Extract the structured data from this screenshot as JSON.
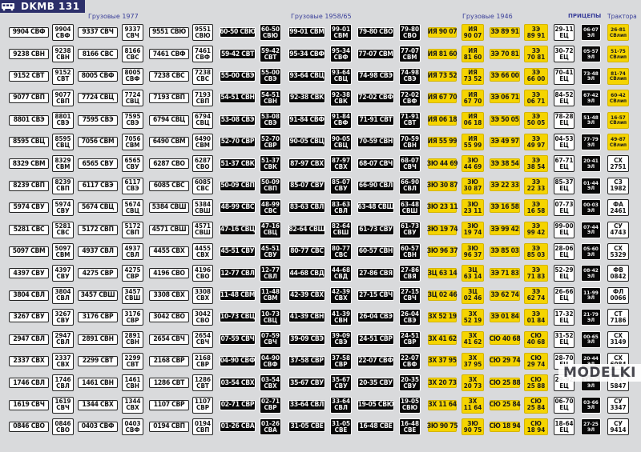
{
  "header": {
    "logo_icon": "bus-logo-icon",
    "title": "DKMB 131",
    "sections": [
      {
        "label": "Грузовые 1977"
      },
      {
        "label": "Грузовые 1958/65"
      },
      {
        "label": "Грузовые 1946"
      },
      {
        "label": "ПРИЦЕПЫ"
      },
      {
        "label": "Трактора"
      }
    ]
  },
  "watermark": "MODELKI",
  "colors": {
    "background": "#d9dadc",
    "header": "#2c2f6a",
    "section_text": "#3a3f9a",
    "plate_1977": "#ffffff",
    "plate_1958": "#080808",
    "plate_1946": "#f5d400"
  },
  "plates_1977": [
    {
      "a": "9904 СВФ",
      "b": "9904\nСВФ",
      "c": "9337 СВЧ",
      "d": "9337\nСВЧ",
      "e": "9551 СВЮ",
      "f": "9551\nСВЮ"
    },
    {
      "a": "9238 СВН",
      "b": "9238\nСВН",
      "c": "8166 СВС",
      "d": "8166\nСВС",
      "e": "7461 СВФ",
      "f": "7461\nСВФ"
    },
    {
      "a": "9152 СВТ",
      "b": "9152\nСВТ",
      "c": "8005 СВФ",
      "d": "8005\nСВФ",
      "e": "7238 СВС",
      "f": "7238\nСВС"
    },
    {
      "a": "9077 СВП",
      "b": "9077\nСВП",
      "c": "7724 СВЦ",
      "d": "7724\nСВЦ",
      "e": "7193 СВП",
      "f": "7193\nСВП"
    },
    {
      "a": "8801 СВЭ",
      "b": "8801\nСВЭ",
      "c": "7595 СВЭ",
      "d": "7595\nСВЭ",
      "e": "6794 СВЦ",
      "f": "6794\nСВЦ"
    },
    {
      "a": "8595 СВЦ",
      "b": "8595\nСВЦ",
      "c": "7056 СВМ",
      "d": "7056\nСВМ",
      "e": "6490 СВМ",
      "f": "6490\nСВМ"
    },
    {
      "a": "8329 СВМ",
      "b": "8329\nСВМ",
      "c": "6565 СВУ",
      "d": "6565\nСВУ",
      "e": "6287 СВО",
      "f": "6287\nСВО"
    },
    {
      "a": "8239 СВП",
      "b": "8239\nСВП",
      "c": "6117 СВЭ",
      "d": "6117\nСВЭ",
      "e": "6085 СВС",
      "f": "6085\nСВС"
    },
    {
      "a": "5974 СВУ",
      "b": "5974\nСВУ",
      "c": "5674 СВЦ",
      "d": "5674\nСВЦ",
      "e": "5384 СВШ",
      "f": "5384\nСВШ"
    },
    {
      "a": "5281 СВС",
      "b": "5281\nСВС",
      "c": "5172 СВП",
      "d": "5172\nСВП",
      "e": "4571 СВШ",
      "f": "4571\nСВШ"
    },
    {
      "a": "5097 СВМ",
      "b": "5097\nСВМ",
      "c": "4937 СВЛ",
      "d": "4937\nСВЛ",
      "e": "4455 СВХ",
      "f": "4455\nСВХ"
    },
    {
      "a": "4397 СВУ",
      "b": "4397\nСВУ",
      "c": "4275 СВР",
      "d": "4275\nСВР",
      "e": "4196 СВО",
      "f": "4196\nСВО"
    },
    {
      "a": "3804 СВЛ",
      "b": "3804\nСВЛ",
      "c": "3457 СВШ",
      "d": "3457\nСВШ",
      "e": "3308 СВХ",
      "f": "3308\nСВХ"
    },
    {
      "a": "3267 СВУ",
      "b": "3267\nСВУ",
      "c": "3176 СВР",
      "d": "3176\nСВР",
      "e": "3042 СВО",
      "f": "3042\nСВО"
    },
    {
      "a": "2947 СВЛ",
      "b": "2947\nСВЛ",
      "c": "2891 СВН",
      "d": "2891\nСВН",
      "e": "2654 СВЧ",
      "f": "2654\nСВЧ"
    },
    {
      "a": "2337 СВХ",
      "b": "2337\nСВХ",
      "c": "2299 СВТ",
      "d": "2299\nСВТ",
      "e": "2168 СВР",
      "f": "2168\nСВР"
    },
    {
      "a": "1746 СВЛ",
      "b": "1746\nСВЛ",
      "c": "1461 СВН",
      "d": "1461\nСВН",
      "e": "1286 СВТ",
      "f": "1286\nСВТ"
    },
    {
      "a": "1619 СВЧ",
      "b": "1619\nСВЧ",
      "c": "1344 СВХ",
      "d": "1344\nСВХ",
      "e": "1107 СВР",
      "f": "1107\nСВР"
    },
    {
      "a": "0846 СВО",
      "b": "0846\nСВО",
      "c": "0403 СВФ",
      "d": "0403\nСВФ",
      "e": "0194 СВП",
      "f": "0194\nСВП"
    }
  ],
  "plates_1958": [
    {
      "a": "60-50 СВЮ",
      "b": "60-50\nСВЮ",
      "c": "99-01 СВМ",
      "d": "99-01\nСВМ",
      "e": "79-80 СВО",
      "f": "79-80\nСВО"
    },
    {
      "a": "59-42 СВТ",
      "b": "59-42\nСВТ",
      "c": "95-34 СВФ",
      "d": "95-34\nСВФ",
      "e": "77-07 СВМ",
      "f": "77-07\nСВМ"
    },
    {
      "a": "55-00 СВЭ",
      "b": "55-00\nСВЭ",
      "c": "93-64 СВЦ",
      "d": "93-64\nСВЦ",
      "e": "74-98 СВЭ",
      "f": "74-98\nСВЭ"
    },
    {
      "a": "54-51 СВН",
      "b": "54-51\nСВН",
      "c": "92-38 СВК",
      "d": "92-38\nСВК",
      "e": "72-02 СВФ",
      "f": "72-02\nСВФ"
    },
    {
      "a": "53-08 СВЭ",
      "b": "53-08\nСВЭ",
      "c": "91-84 СВФ",
      "d": "91-84\nСВФ",
      "e": "71-91 СВТ",
      "f": "71-91\nСВТ"
    },
    {
      "a": "52-70 СВР",
      "b": "52-70\nСВР",
      "c": "90-05 СВЦ",
      "d": "90-05\nСВЦ",
      "e": "70-59 СВН",
      "f": "70-59\nСВН"
    },
    {
      "a": "51-37 СВК",
      "b": "51-37\nСВК",
      "c": "87-97 СВХ",
      "d": "87-97\nСВХ",
      "e": "68-07 СВЧ",
      "f": "68-07\nСВЧ"
    },
    {
      "a": "50-09 СВП",
      "b": "50-09\nСВП",
      "c": "85-07 СВУ",
      "d": "85-07\nСВУ",
      "e": "66-90 СВЛ",
      "f": "66-90\nСВЛ"
    },
    {
      "a": "48-99 СВС",
      "b": "48-99\nСВС",
      "c": "83-63 СВЛ",
      "d": "83-63\nСВЛ",
      "e": "63-48 СВШ",
      "f": "63-48\nСВШ"
    },
    {
      "a": "47-16 СВЦ",
      "b": "47-16\nСВЦ",
      "c": "82-64 СВШ",
      "d": "82-64\nСВШ",
      "e": "61-73 СВУ",
      "f": "61-73\nСВУ"
    },
    {
      "a": "45-51 СВУ",
      "b": "45-51\nСВУ",
      "c": "80-77 СВС",
      "d": "80-77\nСВС",
      "e": "60-57 СВН",
      "f": "60-57\nСВН"
    },
    {
      "a": "12-77 СВЛ",
      "b": "12-77\nСВЛ",
      "c": "44-68 СВД",
      "d": "44-68\nСВД",
      "e": "27-86 СВЯ",
      "f": "27-86\nСВЯ"
    },
    {
      "a": "11-48 СВМ",
      "b": "11-48\nСВМ",
      "c": "42-39 СВХ",
      "d": "42-39\nСВХ",
      "e": "27-15 СВЧ",
      "f": "27-15\nСВЧ"
    },
    {
      "a": "10-73 СВЦ",
      "b": "10-73\nСВЦ",
      "c": "41-39 СВН",
      "d": "41-39\nСВН",
      "e": "26-04 СВЭ",
      "f": "26-04\nСВЭ"
    },
    {
      "a": "07-59 СВЧ",
      "b": "07-59\nСВЧ",
      "c": "39-09 СВЭ",
      "d": "39-09\nСВЭ",
      "e": "24-51 СВР",
      "f": "24-51\nСВР"
    },
    {
      "a": "04-90 СВФ",
      "b": "04-90\nСВФ",
      "c": "37-58 СВР",
      "d": "37-58\nСВР",
      "e": "22-07 СВФ",
      "f": "22-07\nСВФ"
    },
    {
      "a": "03-54 СВХ",
      "b": "03-54\nСВХ",
      "c": "35-67 СВУ",
      "d": "35-67\nСВУ",
      "e": "20-35 СВУ",
      "f": "20-35\nСВУ"
    },
    {
      "a": "02-71 СВР",
      "b": "02-71\nСВР",
      "c": "33-64 СВЛ",
      "d": "33-64\nСВЛ",
      "e": "19-05 СВЮ",
      "f": "19-05\nСВЮ"
    },
    {
      "a": "01-26 СВА",
      "b": "01-26\nСВА",
      "c": "31-05 СВЕ",
      "d": "31-05\nСВЕ",
      "e": "16-48 СВЕ",
      "f": "16-48\nСВЕ"
    }
  ],
  "plates_1946": [
    {
      "a": "ИЯ 90 07",
      "b": "ИЯ\n90 07",
      "c": "ЗЭ 89 91",
      "d": "ЗЭ\n89 91"
    },
    {
      "a": "ИЯ 81 60",
      "b": "ИЯ\n81 60",
      "c": "ЗЭ 70 81",
      "d": "ЗЭ\n70 81"
    },
    {
      "a": "ИЯ 73 52",
      "b": "ИЯ\n73 52",
      "c": "ЗЭ 66 00",
      "d": "ЗЭ\n66 00"
    },
    {
      "a": "ИЯ 67 70",
      "b": "ИЯ\n67 70",
      "c": "ЗЭ 06 71",
      "d": "ЗЭ\n06 71"
    },
    {
      "a": "ИЯ 06 18",
      "b": "ИЯ\n06 18",
      "c": "ЗЭ 50 05",
      "d": "ЗЭ\n50 05"
    },
    {
      "a": "ИЯ 55 99",
      "b": "ИЯ\n55 99",
      "c": "ЗЭ 49 97",
      "d": "ЗЭ\n49 97"
    },
    {
      "a": "ЗЮ 44 69",
      "b": "ЗЮ\n44 69",
      "c": "ЗЭ 38 54",
      "d": "ЗЭ\n38 54"
    },
    {
      "a": "ЗЮ 30 87",
      "b": "ЗЮ\n30 87",
      "c": "ЗЭ 22 33",
      "d": "ЗЭ\n22 33"
    },
    {
      "a": "ЗЮ 23 11",
      "b": "ЗЮ\n23 11",
      "c": "ЗЭ 16 58",
      "d": "ЗЭ\n16 58"
    },
    {
      "a": "ЗЮ 19 74",
      "b": "ЗЮ\n19 74",
      "c": "ЗЭ 99 42",
      "d": "ЗЭ\n99 42"
    },
    {
      "a": "ЗЮ 96 37",
      "b": "ЗЮ\n96 37",
      "c": "ЗЭ 85 03",
      "d": "ЗЭ\n85 03"
    },
    {
      "a": "ЗЦ 63 14",
      "b": "ЗЦ\n63 14",
      "c": "ЗЭ 71 83",
      "d": "ЗЭ\n71 83"
    },
    {
      "a": "ЗЦ 02 46",
      "b": "ЗЦ\n02 46",
      "c": "ЗЭ 62 74",
      "d": "ЗЭ\n62 74"
    },
    {
      "a": "ЗХ 52 19",
      "b": "ЗХ\n52 19",
      "c": "ЗЭ 01 84",
      "d": "ЗЭ\n01 84"
    },
    {
      "a": "ЗХ 41 62",
      "b": "ЗХ\n41 62",
      "c": "СЮ 40 68",
      "d": "СЮ\n40 68"
    },
    {
      "a": "ЗХ 37 95",
      "b": "ЗХ\n37 95",
      "c": "СЮ 29 74",
      "d": "СЮ\n29 74"
    },
    {
      "a": "ЗХ 20 73",
      "b": "ЗХ\n20 73",
      "c": "СЮ 25 88",
      "d": "СЮ\n25 88"
    },
    {
      "a": "ЗХ 11 64",
      "b": "ЗХ\n11 64",
      "c": "СЮ 25 84",
      "d": "СЮ\n25 84"
    },
    {
      "a": "ЗЮ 90 75",
      "b": "ЗЮ\n90 75",
      "c": "СЮ 18 94",
      "d": "СЮ\n18 94"
    }
  ],
  "trailers": [
    {
      "a": "29-11\nEЦ",
      "b": "06-07\nЭЛ"
    },
    {
      "a": "30-72\nЕЦ",
      "b": "05-57\nЭЛ"
    },
    {
      "a": "70-41\nЕЦ",
      "b": "73-48\nЭЛ"
    },
    {
      "a": "84-52\nЕЦ",
      "b": "67-42\nЭЛ"
    },
    {
      "a": "78-28\nЕЦ",
      "b": "51-48\nЭЛ"
    },
    {
      "a": "04-53\nЕЦ",
      "b": "77-79\nЭЛ"
    },
    {
      "a": "67-71\nЕЦ",
      "b": "20-41\nЭЛ"
    },
    {
      "a": "85-37\nЕЦ",
      "b": "01-44\nЭЛ"
    },
    {
      "a": "07-73\nЕЦ",
      "b": "00-03\nЭЛ"
    },
    {
      "a": "99-00\nЕЦ",
      "b": "07-44\nЭЛ"
    },
    {
      "a": "28-06\nЕЦ",
      "b": "05-60\nЭЛ"
    },
    {
      "a": "52-29\nЕЦ",
      "b": "08-42\nЭЛ"
    },
    {
      "a": "26-66\nЕЦ",
      "b": "11-99\nЭЛ"
    },
    {
      "a": "17-32\nЕЦ",
      "b": "21-79\nЭЛ"
    },
    {
      "a": "31-52\nЕЦ",
      "b": "00-65\nЭЛ"
    },
    {
      "a": "28-70\nЕЦ",
      "b": "20-44\nЭЛ"
    },
    {
      "a": "29-92\nЕЦ",
      "b": "14-76\nЭЛ"
    },
    {
      "a": "06-70\nЕЦ",
      "b": "03-66\nЭЛ"
    },
    {
      "a": "18-64\nЕЦ",
      "b": "27-25\nЭЛ"
    }
  ],
  "tractors": [
    "26-81\nСВлип",
    "51-75\nСВлип",
    "81-74\nСВлип",
    "60-42\nСВлип",
    "16-57\nСВлип",
    "49-87\nСВлип",
    "СХ\n2751",
    "СЗ\n1982",
    "ФА\n2461",
    "СУ\n4743",
    "СХ\n5329",
    "ФВ\n0842",
    "ФЛ\n0066",
    "СТ\n7186",
    "СХ\n3149",
    "СХ\n6084",
    "СХ\n5847",
    "СУ\n3347",
    "СУ\n9414"
  ]
}
